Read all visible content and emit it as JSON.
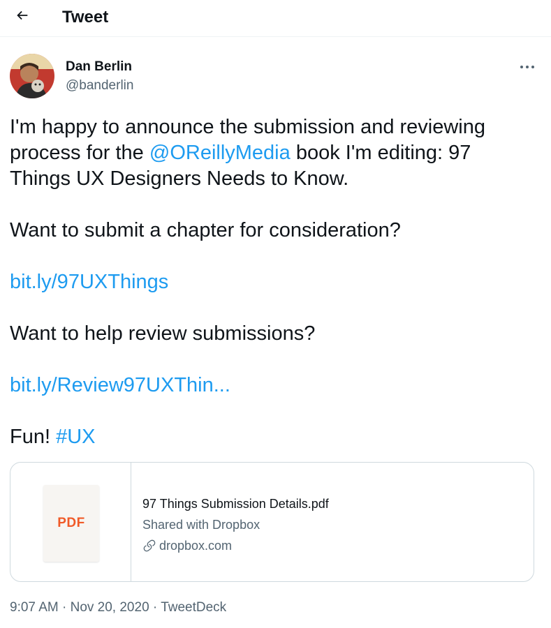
{
  "header": {
    "title": "Tweet",
    "back_icon": "arrow-left-icon"
  },
  "author": {
    "name": "Dan Berlin",
    "handle": "@banderlin",
    "avatar_icon": "avatar-photo"
  },
  "more_icon": "more-horizontal-icon",
  "tweet": {
    "p1_a": "I'm happy to announce the submission and reviewing process for the ",
    "mention": "@OReillyMedia",
    "p1_b": " book I'm editing: 97 Things UX Designers Needs to Know.",
    "p2": "Want to submit a chapter for consideration?",
    "link1": "bit.ly/97UXThings",
    "p3": "Want to help review submissions?",
    "link2": "bit.ly/Review97UXThin...",
    "p4": "Fun! ",
    "hashtag": "#UX"
  },
  "card": {
    "thumb_label": "PDF",
    "title": "97 Things Submission Details.pdf",
    "description": "Shared with Dropbox",
    "domain": "dropbox.com",
    "domain_icon": "link-icon"
  },
  "meta": {
    "time": "9:07 AM",
    "sep1": "·",
    "date": "Nov 20, 2020",
    "sep2": "·",
    "source": "TweetDeck"
  },
  "colors": {
    "link": "#1d9bf0",
    "text": "#0f1419",
    "secondary": "#536471",
    "border": "#cfd9de",
    "pdf": "#f05a28"
  }
}
